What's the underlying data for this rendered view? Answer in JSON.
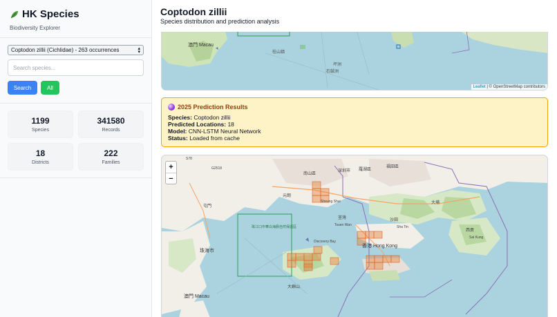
{
  "sidebar": {
    "app_title": "HK Species",
    "app_subtitle": "Biodiversity Explorer",
    "species_select_value": "Coptodon zillii (Cichlidae) - 263 occurrences",
    "search_placeholder": "Search species...",
    "search_button": "Search",
    "all_button": "All",
    "stats": [
      {
        "value": "1199",
        "label": "Species"
      },
      {
        "value": "341580",
        "label": "Records"
      },
      {
        "value": "18",
        "label": "Districts"
      },
      {
        "value": "222",
        "label": "Families"
      }
    ]
  },
  "header": {
    "title": "Coptodon zillii",
    "subtitle": "Species distribution and prediction analysis"
  },
  "map_top": {
    "labels": [
      "澳門 Macau",
      "桂山鎮",
      "坪洲",
      "石鼓洲"
    ],
    "attribution_link": "Leaflet",
    "attribution_text": "| © OpenStreetMap contributors"
  },
  "prediction": {
    "title": "2025 Prediction Results",
    "species_label": "Species:",
    "species_value": "Coptodon zillii",
    "locations_label": "Predicted Locations:",
    "locations_value": "18",
    "model_label": "Model:",
    "model_value": "CNN-LSTM Neural Network",
    "status_label": "Status:",
    "status_value": "Loaded from cache"
  },
  "map_bottom": {
    "zoom_in": "+",
    "zoom_out": "−",
    "labels": [
      "南山區",
      "深圳市",
      "羅湖區",
      "福田區",
      "元朗",
      "屯門",
      "荃灣",
      "沙田",
      "大埔",
      "西貢",
      "珠海市",
      "香港 Hong Kong",
      "澳門 Macau",
      "大嶼山",
      "珠江口中華白海豚自然保護區",
      "Discovery Bay",
      "Tsuen Wan",
      "Sha Tin",
      "Sai Kung",
      "Sheung Shui",
      "G2518",
      "S78"
    ],
    "accent_color": "#e8833a"
  }
}
